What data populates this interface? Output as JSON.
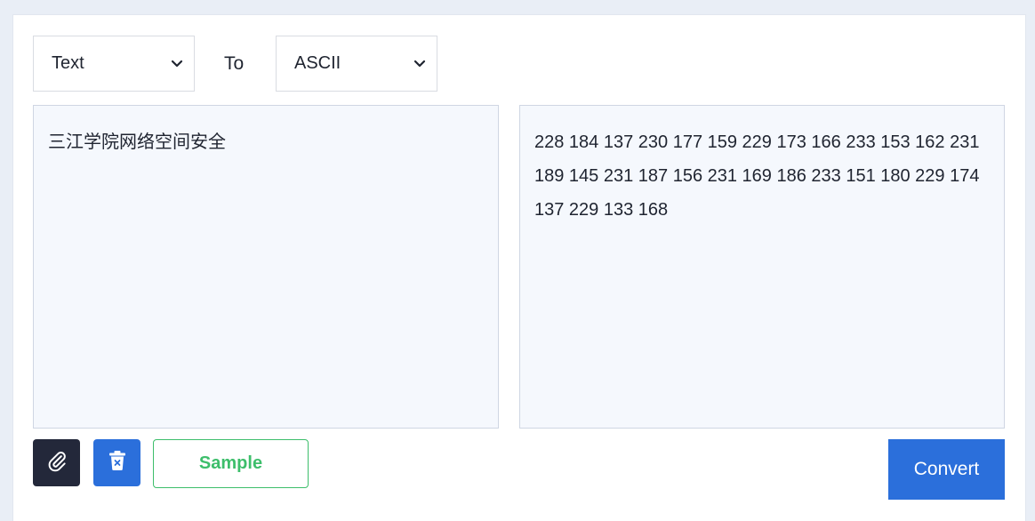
{
  "converter": {
    "from_select": {
      "value": "Text"
    },
    "to_label": "To",
    "to_select": {
      "value": "ASCII"
    },
    "input_text": "三江学院网络空间安全",
    "output_text": "228 184 137 230 177 159 229 173 166 233 153 162 231 189 145 231 187 156 231 169 186 233 151 180 229 174 137 229 133 168"
  },
  "actions": {
    "attach_icon": "paperclip-icon",
    "clear_icon": "trash-x-icon",
    "sample_label": "Sample",
    "convert_label": "Convert"
  },
  "colors": {
    "accent_blue": "#2b6fdb",
    "dark_button": "#23283a",
    "sample_green": "#3dbe6b",
    "panel_bg": "#f5f8fd"
  }
}
